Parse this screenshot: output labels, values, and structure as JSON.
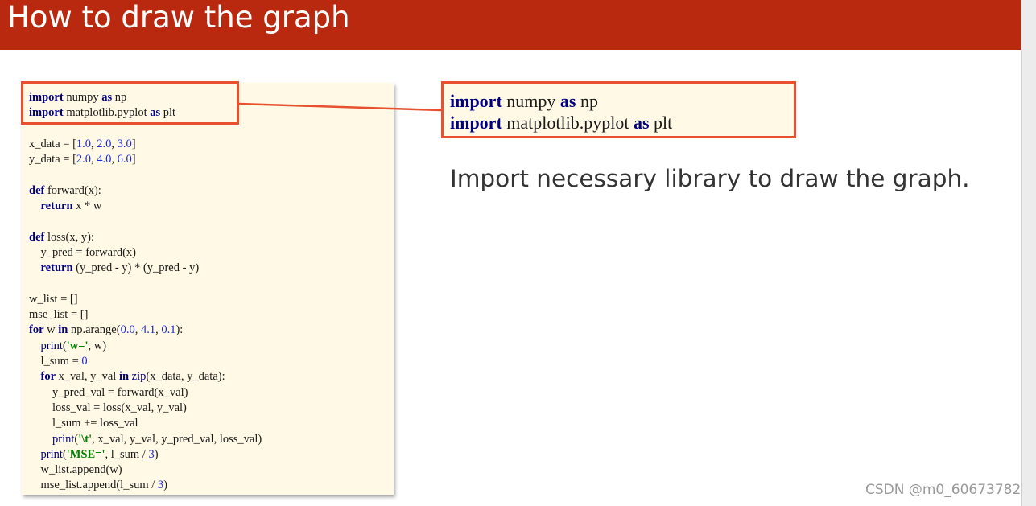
{
  "header": {
    "title": "How to draw the graph"
  },
  "code_panel": {
    "lines": [
      [
        {
          "t": "import",
          "c": "kw"
        },
        {
          "t": " numpy "
        },
        {
          "t": "as",
          "c": "kw"
        },
        {
          "t": " np"
        }
      ],
      [
        {
          "t": "import",
          "c": "kw"
        },
        {
          "t": " matplotlib.pyplot "
        },
        {
          "t": "as",
          "c": "kw"
        },
        {
          "t": " plt"
        }
      ],
      [],
      [
        {
          "t": "x_data = ["
        },
        {
          "t": "1.0",
          "c": "num"
        },
        {
          "t": ", "
        },
        {
          "t": "2.0",
          "c": "num"
        },
        {
          "t": ", "
        },
        {
          "t": "3.0",
          "c": "num"
        },
        {
          "t": "]"
        }
      ],
      [
        {
          "t": "y_data = ["
        },
        {
          "t": "2.0",
          "c": "num"
        },
        {
          "t": ", "
        },
        {
          "t": "4.0",
          "c": "num"
        },
        {
          "t": ", "
        },
        {
          "t": "6.0",
          "c": "num"
        },
        {
          "t": "]"
        }
      ],
      [],
      [
        {
          "t": "def",
          "c": "kw"
        },
        {
          "t": " forward(x):"
        }
      ],
      [
        {
          "t": "    "
        },
        {
          "t": "return",
          "c": "kw"
        },
        {
          "t": " x * w"
        }
      ],
      [],
      [
        {
          "t": "def",
          "c": "kw"
        },
        {
          "t": " loss(x, y):"
        }
      ],
      [
        {
          "t": "    y_pred = forward(x)"
        }
      ],
      [
        {
          "t": "    "
        },
        {
          "t": "return",
          "c": "kw"
        },
        {
          "t": " (y_pred - y) * (y_pred - y)"
        }
      ],
      [],
      [
        {
          "t": "w_list = []"
        }
      ],
      [
        {
          "t": "mse_list = []"
        }
      ],
      [
        {
          "t": "for",
          "c": "kw"
        },
        {
          "t": " w "
        },
        {
          "t": "in",
          "c": "kw"
        },
        {
          "t": " np.arange("
        },
        {
          "t": "0.0",
          "c": "num"
        },
        {
          "t": ", "
        },
        {
          "t": "4.1",
          "c": "num"
        },
        {
          "t": ", "
        },
        {
          "t": "0.1",
          "c": "num"
        },
        {
          "t": "):"
        }
      ],
      [
        {
          "t": "    "
        },
        {
          "t": "print",
          "c": "builtin"
        },
        {
          "t": "("
        },
        {
          "t": "'w='",
          "c": "str"
        },
        {
          "t": ", w)"
        }
      ],
      [
        {
          "t": "    l_sum = "
        },
        {
          "t": "0",
          "c": "num"
        }
      ],
      [
        {
          "t": "    "
        },
        {
          "t": "for",
          "c": "kw"
        },
        {
          "t": " x_val, y_val "
        },
        {
          "t": "in",
          "c": "kw"
        },
        {
          "t": " "
        },
        {
          "t": "zip",
          "c": "builtin"
        },
        {
          "t": "(x_data, y_data):"
        }
      ],
      [
        {
          "t": "        y_pred_val = forward(x_val)"
        }
      ],
      [
        {
          "t": "        loss_val = loss(x_val, y_val)"
        }
      ],
      [
        {
          "t": "        l_sum += loss_val"
        }
      ],
      [
        {
          "t": "        "
        },
        {
          "t": "print",
          "c": "builtin"
        },
        {
          "t": "("
        },
        {
          "t": "'\\t'",
          "c": "str"
        },
        {
          "t": ", x_val, y_val, y_pred_val, loss_val)"
        }
      ],
      [
        {
          "t": "    "
        },
        {
          "t": "print",
          "c": "builtin"
        },
        {
          "t": "("
        },
        {
          "t": "'MSE='",
          "c": "str"
        },
        {
          "t": ", l_sum / "
        },
        {
          "t": "3",
          "c": "num"
        },
        {
          "t": ")"
        }
      ],
      [
        {
          "t": "    w_list.append(w)"
        }
      ],
      [
        {
          "t": "    mse_list.append(l_sum / "
        },
        {
          "t": "3",
          "c": "num"
        },
        {
          "t": ")"
        }
      ]
    ]
  },
  "enlarged_code": {
    "lines": [
      [
        {
          "t": "import",
          "c": "kw"
        },
        {
          "t": " numpy "
        },
        {
          "t": "as",
          "c": "kw"
        },
        {
          "t": " np"
        }
      ],
      [
        {
          "t": "import",
          "c": "kw"
        },
        {
          "t": " matplotlib.pyplot "
        },
        {
          "t": "as",
          "c": "kw"
        },
        {
          "t": " plt"
        }
      ]
    ]
  },
  "description": "Import necessary library to draw the graph.",
  "watermark": "CSDN @m0_60673782",
  "colors": {
    "title_bar": "#b8290f",
    "highlight_border": "#e8502f",
    "code_background": "#fff9e6",
    "keyword": "#000080",
    "number": "#1a2bd6",
    "string": "#008000"
  }
}
